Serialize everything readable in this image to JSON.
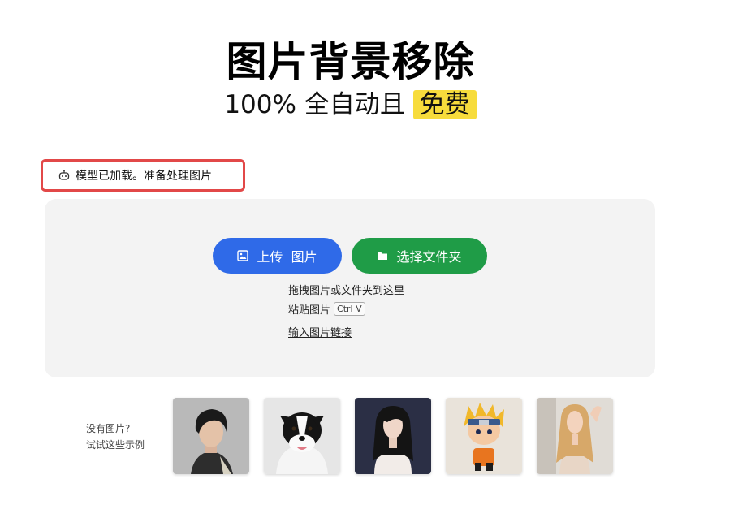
{
  "hero": {
    "title": "图片背景移除",
    "subtitle_prefix": "100% 全自动且",
    "subtitle_highlight": "免费"
  },
  "status": {
    "icon": "robot-icon",
    "text": "模型已加载。准备处理图片"
  },
  "upload": {
    "upload_icon": "image-icon",
    "upload_label": "上传  图片",
    "folder_icon": "folder-icon",
    "folder_label": "选择文件夹",
    "drag_hint": "拖拽图片或文件夹到这里",
    "paste_hint": "粘贴图片",
    "paste_shortcut": "Ctrl V",
    "url_link": "输入图片链接"
  },
  "samples": {
    "line1": "没有图片?",
    "line2": "试试这些示例",
    "items": [
      "sample-man",
      "sample-dog",
      "sample-woman",
      "sample-figure",
      "sample-blonde"
    ]
  },
  "colors": {
    "accent_blue": "#2f6ae8",
    "accent_green": "#1f9c47",
    "highlight_yellow": "#f7dc3c",
    "status_border": "#e24848"
  }
}
